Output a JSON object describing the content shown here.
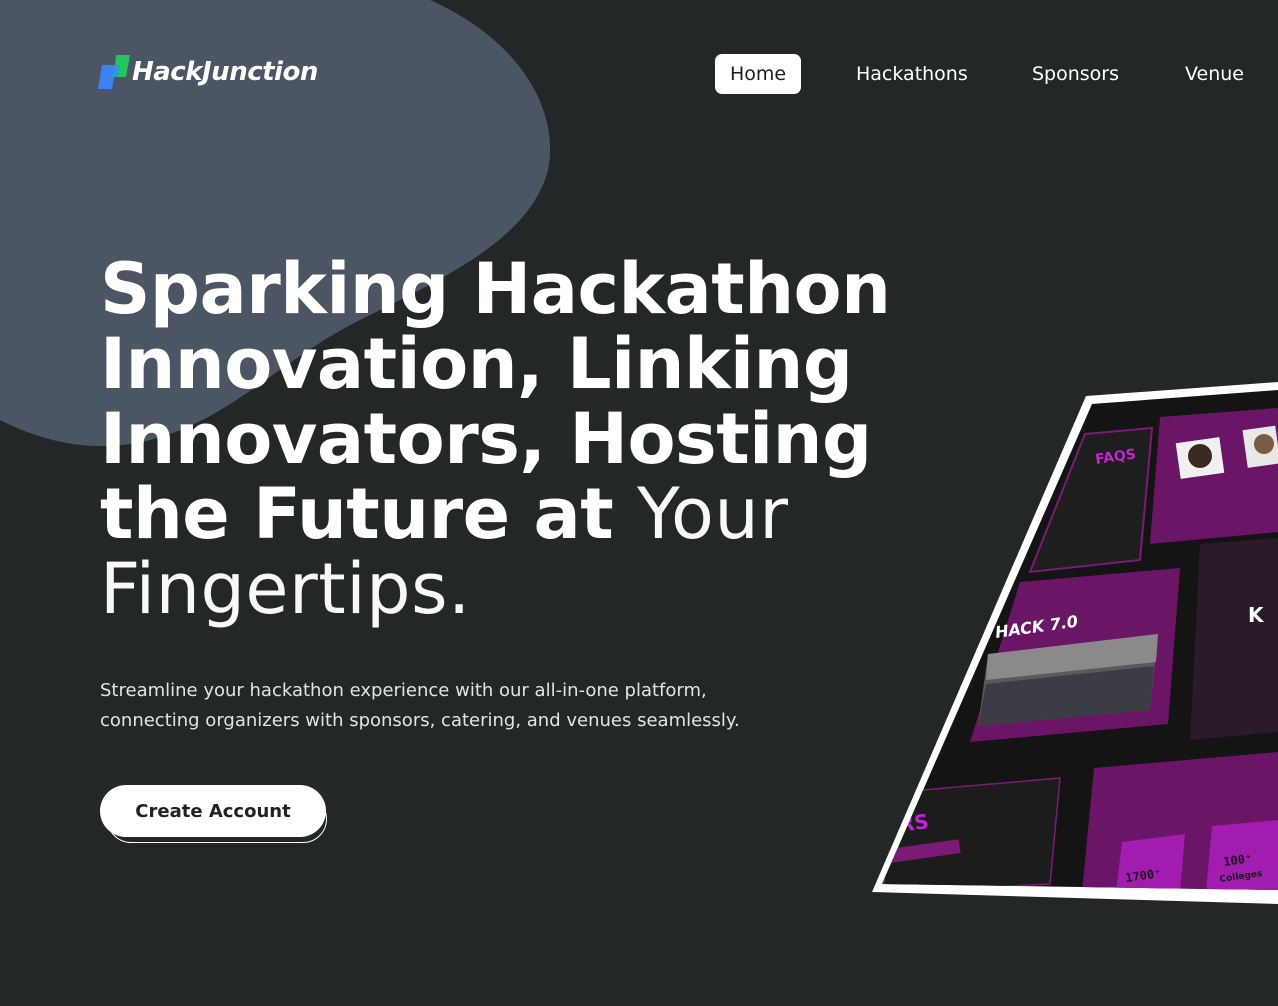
{
  "brand": {
    "name": "HackJunction",
    "logo_icon": "parallelogram-blocks-icon"
  },
  "nav": {
    "items": [
      {
        "label": "Home",
        "active": true
      },
      {
        "label": "Hackathons",
        "active": false
      },
      {
        "label": "Sponsors",
        "active": false
      },
      {
        "label": "Venue",
        "active": false
      }
    ]
  },
  "hero": {
    "title_bold": "Sparking Hackathon Innovation, Linking Innovators, Hosting the Future at",
    "title_light": "Your Fingertips.",
    "subtitle": "Streamline your hackathon experience with our all-in-one platform, connecting organizers with sponsors, catering, and venues seamlessly.",
    "cta_label": "Create Account"
  },
  "mockup": {
    "faqs_label": "FAQS",
    "hack_label": "HACK 7.0",
    "sponsors_label": "RS",
    "stat1_value": "1700⁺",
    "stat2_value": "100⁺",
    "stat2_label": "Colleges"
  },
  "colors": {
    "background": "#242728",
    "blob": "#4b5563",
    "accent_magenta": "#8b1a87",
    "logo_blue": "#3b82f6",
    "logo_green": "#22c55e"
  }
}
